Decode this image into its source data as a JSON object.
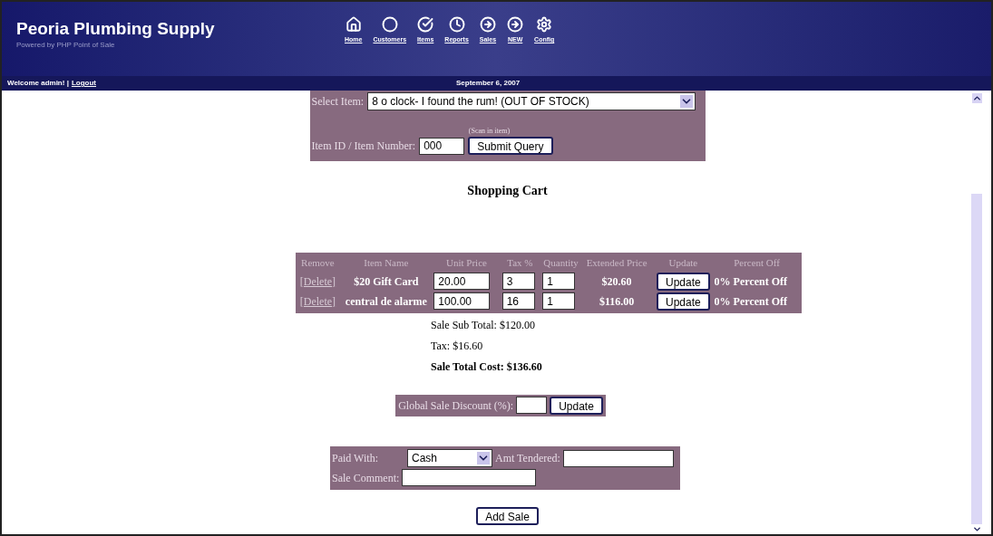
{
  "header": {
    "title": "Peoria Plumbing Supply",
    "subtitle": "Powered by PHP Point of Sale",
    "nav": [
      {
        "label": "Home",
        "kind": "home"
      },
      {
        "label": "Customers",
        "kind": "customers"
      },
      {
        "label": "Items",
        "kind": "items"
      },
      {
        "label": "Reports",
        "kind": "reports"
      },
      {
        "label": "Sales",
        "kind": "sales"
      },
      {
        "label": "NEW",
        "kind": "sales"
      },
      {
        "label": "Config",
        "kind": "config"
      }
    ]
  },
  "welcome_bar": {
    "welcome": "Welcome admin! |",
    "logout": "Logout",
    "date": "September 6, 2007"
  },
  "item_form": {
    "select_label": "Select Item:",
    "select_value": "8 o clock- I found the rum! (OUT OF STOCK)",
    "hint": "(Scan in item)",
    "id_label": "Item ID / Item Number:",
    "id_value": "000",
    "submit": "Submit Query"
  },
  "cart": {
    "title": "Shopping Cart",
    "columns": [
      "Remove",
      "Item Name",
      "Unit Price",
      "Tax %",
      "Quantity",
      "Extended Price",
      "Update",
      "Percent Off"
    ],
    "rows": [
      {
        "remove": "[Delete]",
        "name": "$20 Gift Card",
        "unit_price": "20.00",
        "tax": "3",
        "quantity": "1",
        "extended": "$20.60",
        "update": "Update",
        "percent_off": "0% Percent Off"
      },
      {
        "remove": "[Delete]",
        "name": "central de alarme",
        "unit_price": "100.00",
        "tax": "16",
        "quantity": "1",
        "extended": "$116.00",
        "update": "Update",
        "percent_off": "0% Percent Off"
      }
    ]
  },
  "totals": {
    "subtotal": "Sale Sub Total: $120.00",
    "tax": "Tax: $16.60",
    "total": "Sale Total Cost: $136.60"
  },
  "discount": {
    "label": "Global Sale Discount (%):",
    "button": "Update"
  },
  "payment": {
    "paid_label": "Paid With:",
    "paid_value": "Cash",
    "tendered_label": "Amt Tendered:",
    "comment_label": "Sale Comment:"
  },
  "add_sale": "Add Sale"
}
